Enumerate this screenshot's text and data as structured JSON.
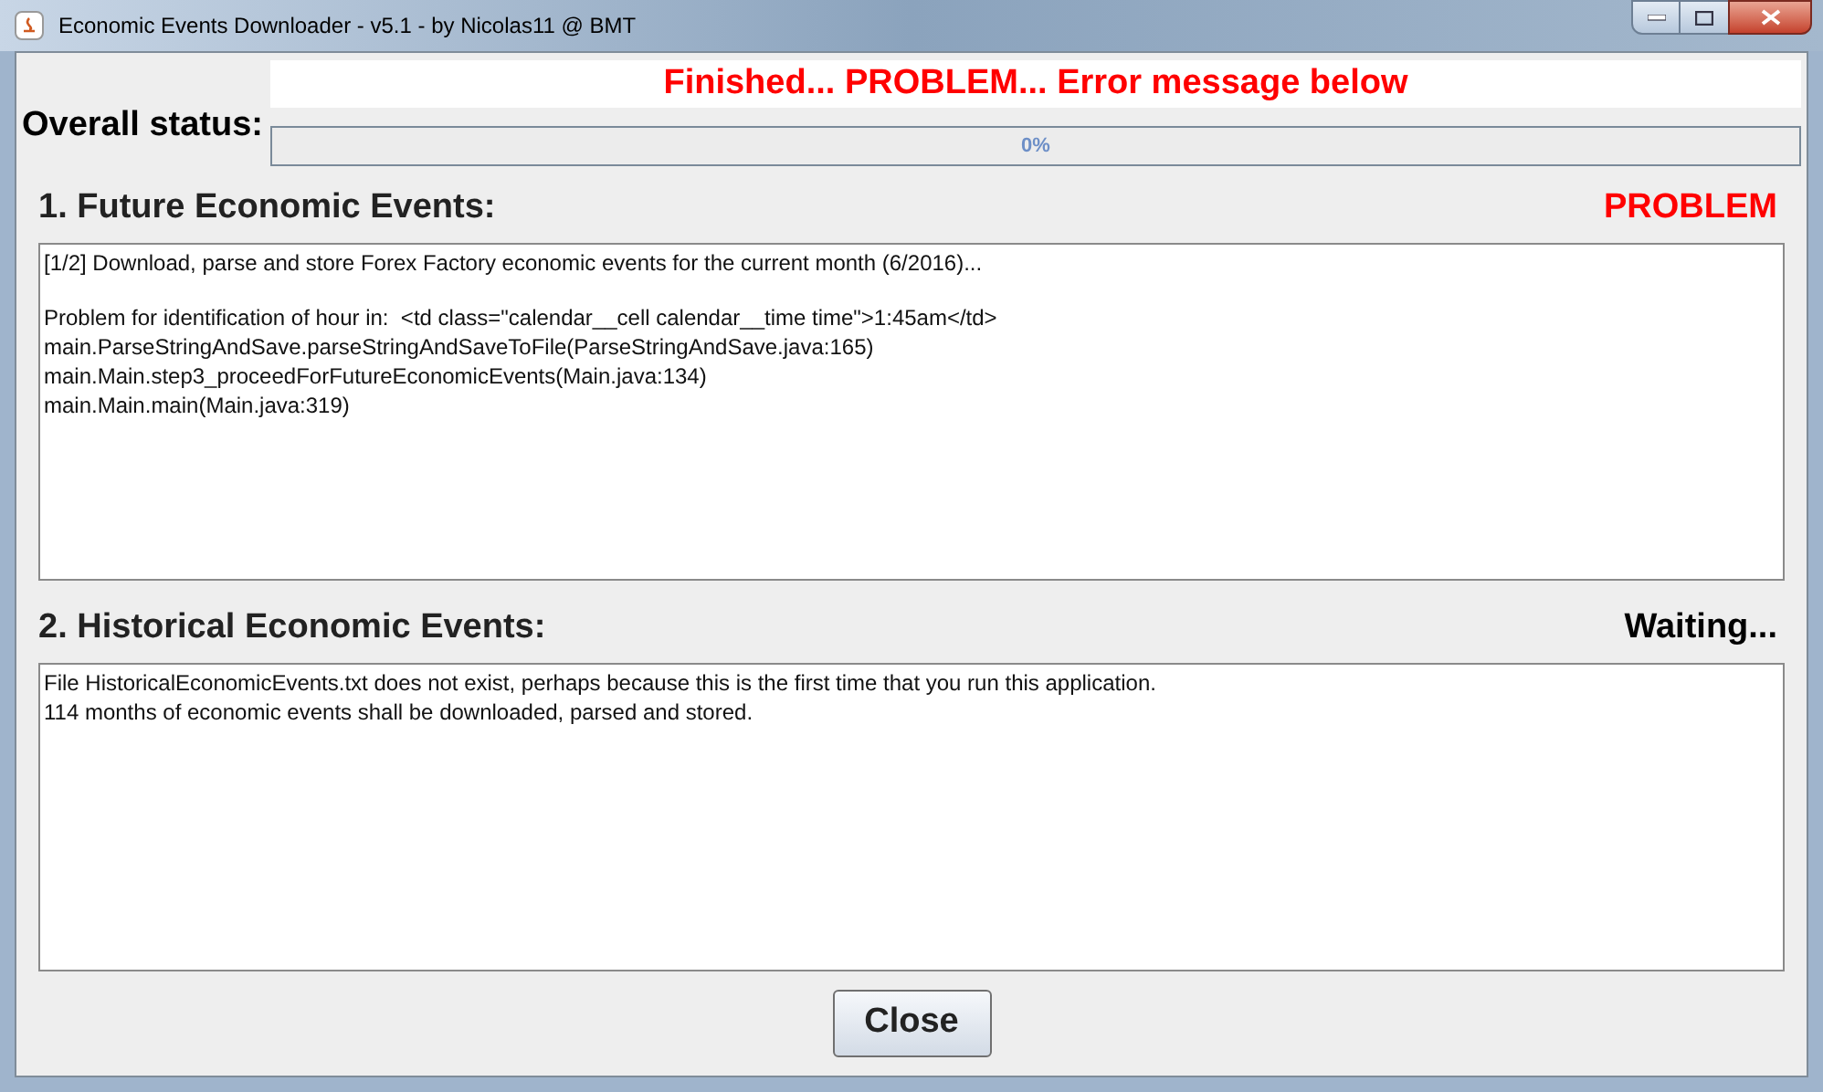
{
  "window": {
    "title": "Economic Events Downloader - v5.1 - by Nicolas11 @ BMT"
  },
  "overall": {
    "label": "Overall status:",
    "message": "Finished... PROBLEM... Error message below",
    "progress": {
      "level": 0,
      "reading": "0%"
    }
  },
  "sections": [
    {
      "title": "1. Future Economic Events:",
      "status": "PROBLEM",
      "color": "#ff0000",
      "log": [
        [
          "[1/2] Download, parse and store Forex Factory economic events for the current month (6/2016)..."
        ],
        [
          "Problem for identification of hour in:  <td class=\"calendar__cell calendar__time time\">1:45am</td>",
          "main.ParseStringAndSave.parseStringAndSaveToFile(ParseStringAndSave.java:165)",
          "main.Main.step3_proceedForFutureEconomicEvents(Main.java:134)",
          "main.Main.main(Main.java:319)"
        ]
      ]
    },
    {
      "title": "2. Historical Economic Events:",
      "status": "Waiting...",
      "color": "#000000",
      "log": [
        [
          "File HistoricalEconomicEvents.txt does not exist, perhaps because this is the first time that you run this application.",
          "114 months of economic events shall be downloaded, parsed and stored."
        ]
      ]
    }
  ],
  "buttons": [
    "Close"
  ]
}
